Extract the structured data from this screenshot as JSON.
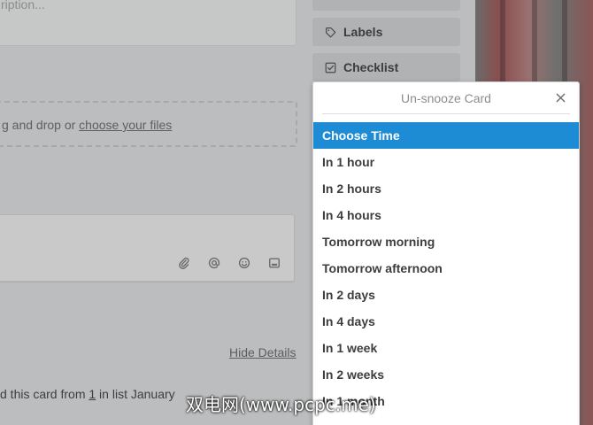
{
  "card": {
    "description_placeholder": "ription...",
    "drop_text": "g and drop or ",
    "drop_link": "choose your files",
    "hide_details": "Hide Details",
    "activity_prefix": "d this card from ",
    "activity_num": "1",
    "activity_suffix": " in list January"
  },
  "sidebar": {
    "labels": "Labels",
    "checklist": "Checklist"
  },
  "popover": {
    "title": "Un-snooze Card",
    "items": [
      "Choose Time",
      "In 1 hour",
      "In 2 hours",
      "In 4 hours",
      "Tomorrow morning",
      "Tomorrow afternoon",
      "In 2 days",
      "In 4 days",
      "In 1 week",
      "In 2 weeks",
      "In 1 month"
    ],
    "selected_index": 0
  },
  "watermark": "双电网(www.pcpc.me)",
  "colors": {
    "accent": "#1d8cd4",
    "overlay": "#bcbdbe"
  }
}
